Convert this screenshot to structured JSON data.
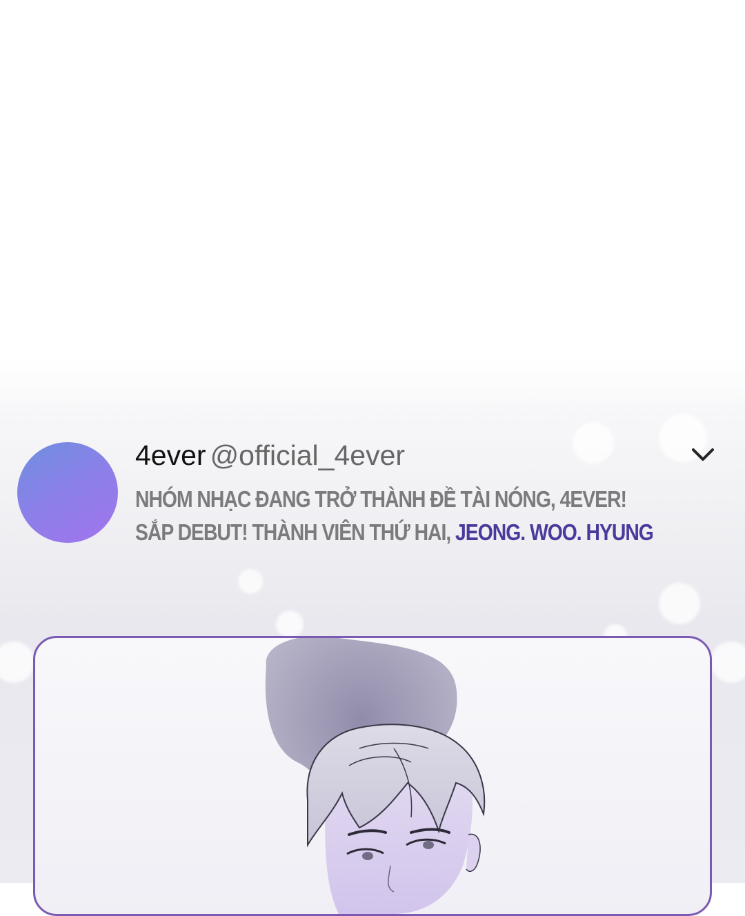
{
  "tweet": {
    "display_name": "4ever",
    "handle": "@official_4ever",
    "line1": "NHÓM NHẠC ĐANG TRỞ THÀNH ĐỀ TÀI NÓNG, 4EVER!",
    "line2_prefix": "SẮP DEBUT! THÀNH VIÊN THỨ HAI, ",
    "line2_mention": "JEONG. WOO. HYUNG",
    "menu_icon": "chevron-down-icon"
  },
  "colors": {
    "mention": "#4b3a9c",
    "panel_border": "#7b5ab3",
    "avatar_start": "#6f8fe0",
    "avatar_end": "#a274ee"
  }
}
